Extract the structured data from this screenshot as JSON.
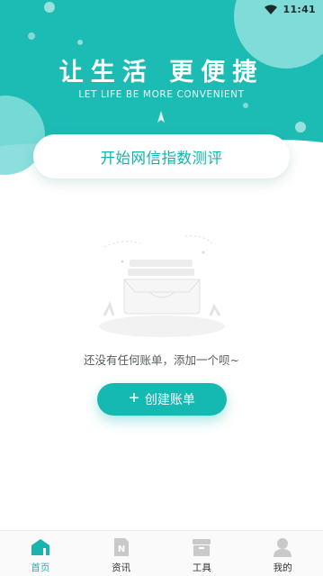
{
  "status_bar": {
    "time": "11:41"
  },
  "header": {
    "slogan": "让生活 更便捷",
    "slogan_sub": "LET LIFE BE MORE CONVENIENT",
    "start_card_label": "开始网信指数测评"
  },
  "empty_state": {
    "message": "还没有任何账单，添加一个呗~",
    "create_button_label": "创建账单"
  },
  "bottom_nav": {
    "items": [
      {
        "label": "首页",
        "icon": "home-icon",
        "active": true
      },
      {
        "label": "资讯",
        "icon": "news-icon",
        "active": false
      },
      {
        "label": "工具",
        "icon": "tools-icon",
        "active": false
      },
      {
        "label": "我的",
        "icon": "profile-icon",
        "active": false
      }
    ]
  },
  "colors": {
    "primary": "#16b9b1",
    "header_teal": "#1cbcb4",
    "bubble": "#7fdcd8",
    "inactive_icon": "#c9c9c9"
  }
}
